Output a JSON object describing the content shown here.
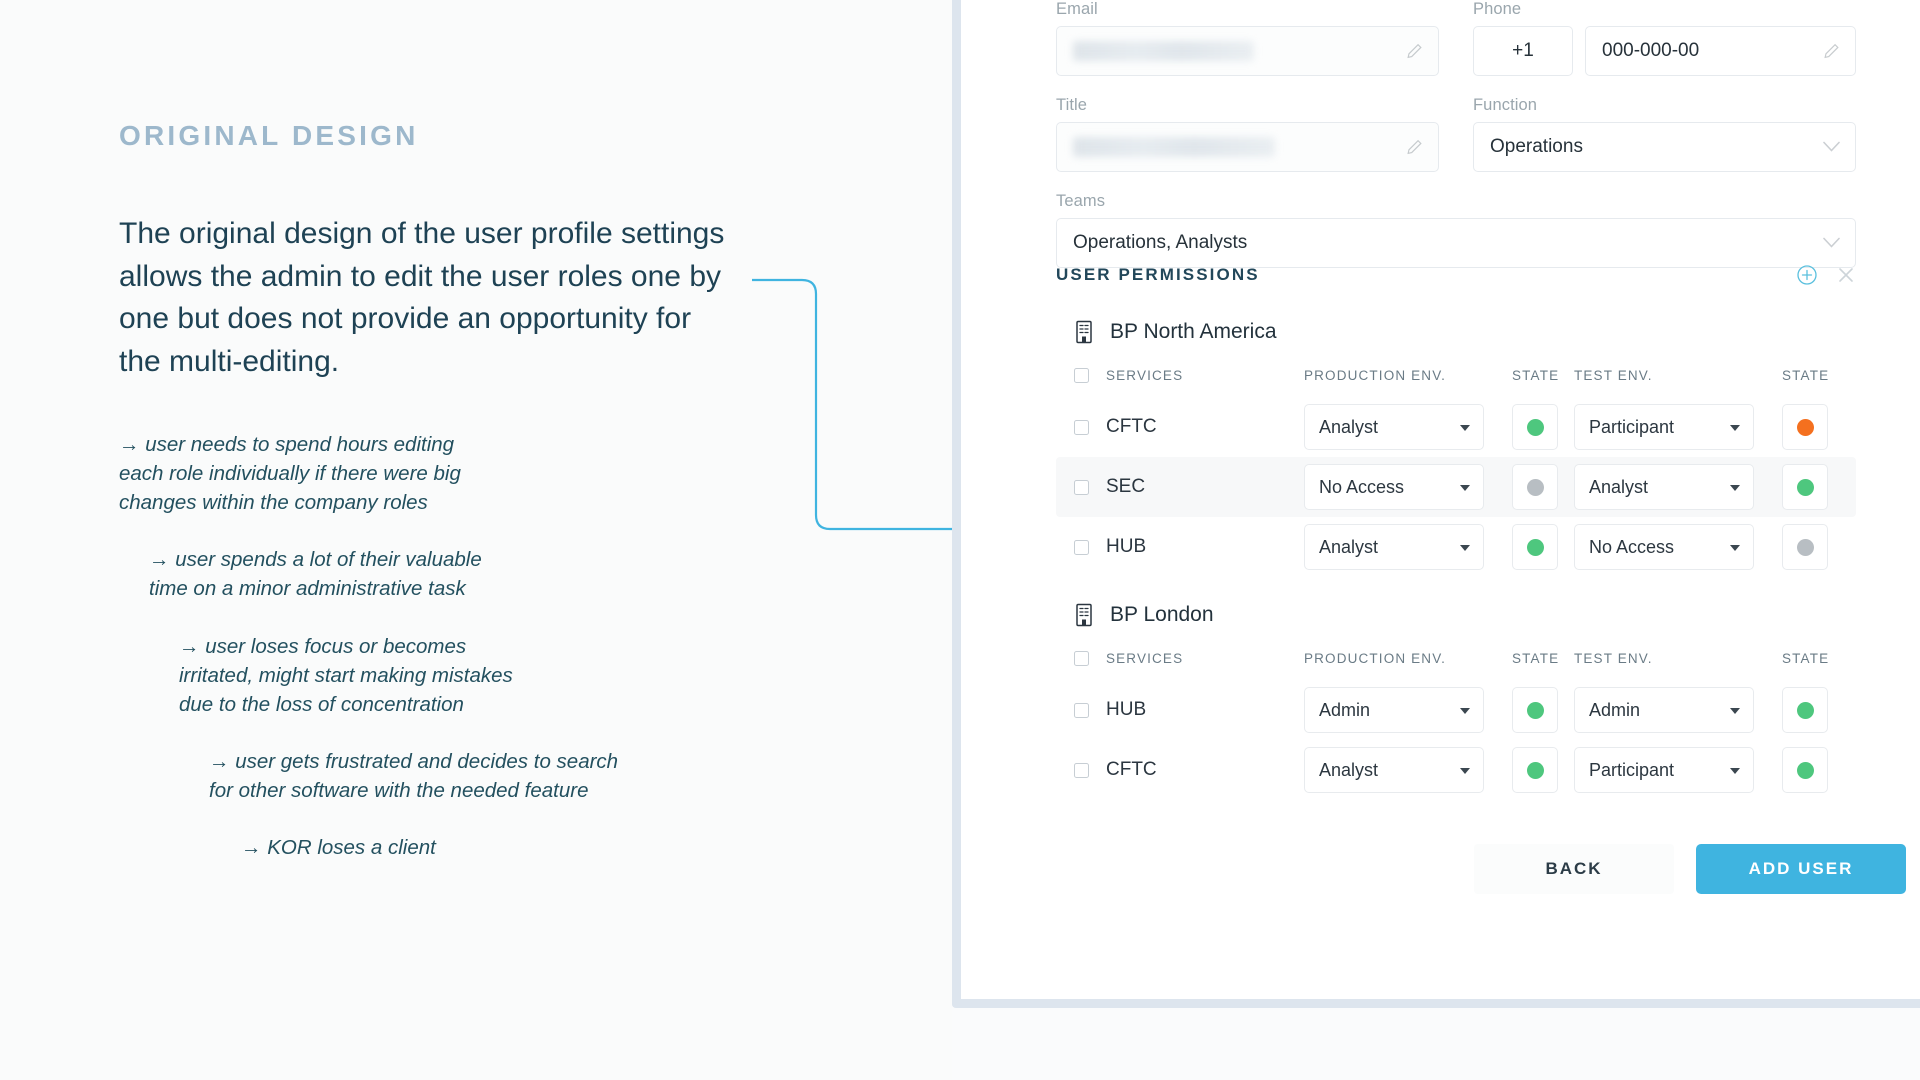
{
  "colors": {
    "accent": "#3fb4e0",
    "eyebrow": "#9db8cc",
    "body_text": "#1e4254",
    "state_active": "#4ec77e",
    "state_pending": "#f4701f",
    "state_none": "#b8bec3",
    "card_border": "#dde5ee"
  },
  "annotation": {
    "eyebrow": "ORIGINAL DESIGN",
    "lede": "The original design of the user profile settings allows the admin to edit the user roles one by one but does not provide an opportunity for the multi-editing.",
    "chain": [
      "→ user needs to spend hours editing\neach role individually if there were big\nchanges within the company roles",
      "→ user spends a lot of their valuable\ntime on a minor administrative task",
      "→ user loses focus or becomes\nirritated, might start making mistakes\ndue to the loss of concentration",
      "→ user gets frustrated and decides to search\nfor other software with the needed feature",
      "→ KOR loses a client"
    ]
  },
  "form": {
    "email": {
      "label": "Email",
      "value": "",
      "redacted": true,
      "edit_icon": "pencil-icon"
    },
    "phone": {
      "label": "Phone",
      "country_code": "+1",
      "value": "000-000-00",
      "edit_icon": "pencil-icon"
    },
    "title": {
      "label": "Title",
      "value": "",
      "redacted": true,
      "edit_icon": "pencil-icon"
    },
    "function": {
      "label": "Function",
      "value": "Operations",
      "icon": "chevron-down-icon"
    },
    "teams": {
      "label": "Teams",
      "value": "Operations,  Analysts",
      "icon": "chevron-down-icon"
    }
  },
  "permissions": {
    "title": "USER PERMISSIONS",
    "add_icon": "plus-circle-icon",
    "close_icon": "close-icon",
    "columns": [
      "SERVICES",
      "PRODUCTION ENV.",
      "STATE",
      "TEST ENV.",
      "STATE"
    ],
    "organizations": [
      {
        "name": "BP North America",
        "icon": "building-icon",
        "rows": [
          {
            "service": "CFTC",
            "production": "Analyst",
            "production_state": "#4ec77e",
            "test": "Participant",
            "test_state": "#f4701f",
            "highlighted": false
          },
          {
            "service": "SEC",
            "production": "No Access",
            "production_state": "#b8bec3",
            "test": "Analyst",
            "test_state": "#4ec77e",
            "highlighted": true
          },
          {
            "service": "HUB",
            "production": "Analyst",
            "production_state": "#4ec77e",
            "test": "No Access",
            "test_state": "#b8bec3",
            "highlighted": false
          }
        ]
      },
      {
        "name": "BP London",
        "icon": "building-icon",
        "rows": [
          {
            "service": "HUB",
            "production": "Admin",
            "production_state": "#4ec77e",
            "test": "Admin",
            "test_state": "#4ec77e",
            "highlighted": false
          },
          {
            "service": "CFTC",
            "production": "Analyst",
            "production_state": "#4ec77e",
            "test": "Participant",
            "test_state": "#4ec77e",
            "highlighted": false
          }
        ]
      }
    ]
  },
  "footer": {
    "back_label": "BACK",
    "add_user_label": "ADD USER"
  }
}
